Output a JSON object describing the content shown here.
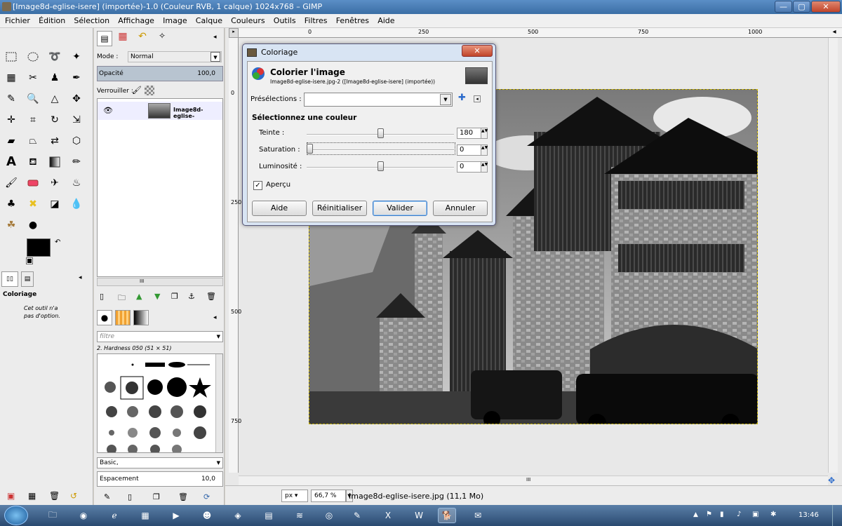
{
  "window": {
    "title": "[Image8d-eglise-isere] (importée)-1.0 (Couleur RVB, 1 calque) 1024x768 – GIMP",
    "min_glyph": "—",
    "max_glyph": "▢",
    "close_glyph": "✕"
  },
  "menubar": [
    "Fichier",
    "Édition",
    "Sélection",
    "Affichage",
    "Image",
    "Calque",
    "Couleurs",
    "Outils",
    "Filtres",
    "Fenêtres",
    "Aide"
  ],
  "toolbox": {
    "tool_options_title": "Coloriage",
    "tool_options_text": "Cet outil n'a pas d'option."
  },
  "layers": {
    "mode_label": "Mode :",
    "mode_value": "Normal",
    "opacity_label": "Opacité",
    "opacity_value": "100,0",
    "lock_label": "Verrouiller :",
    "layer_name": "Image8d-eglise-",
    "scroll_glyph": "III"
  },
  "brushes": {
    "filter_placeholder": "filtre",
    "brush_name": "2. Hardness 050 (51 × 51)",
    "preset_value": "Basic,",
    "spacing_label": "Espacement",
    "spacing_value": "10,0"
  },
  "ruler": {
    "top": [
      "0",
      "250",
      "500",
      "750",
      "1000"
    ],
    "left": [
      "0",
      "250",
      "500",
      "750"
    ]
  },
  "dialog": {
    "title": "Coloriage",
    "heading": "Colorier l'image",
    "subheading": "Image8d-eglise-isere.jpg-2 ([Image8d-eglise-isere] (importée))",
    "presets_label": "Présélections :",
    "section_label": "Sélectionnez une couleur",
    "hue_label": "Teinte :",
    "hue_value": "180",
    "saturation_label": "Saturation :",
    "saturation_value": "0",
    "lightness_label": "Luminosité :",
    "lightness_value": "0",
    "preview_label": "Aperçu",
    "preview_checked": true,
    "buttons": {
      "help": "Aide",
      "reset": "Réinitialiser",
      "ok": "Valider",
      "cancel": "Annuler"
    },
    "hue_level": 0.5,
    "saturation_level": 0.0,
    "lightness_level": 0.5
  },
  "statusbar": {
    "unit": "px",
    "zoom": "66,7 %",
    "file_info": "Image8d-eglise-isere.jpg (11,1 Mo)"
  },
  "taskbar": {
    "clock": "13:46"
  },
  "colors": {
    "fg": "#000000",
    "bg": "#ffffff",
    "titlebar": "#3a6ea5",
    "dialog_accent": "#c0442a"
  }
}
